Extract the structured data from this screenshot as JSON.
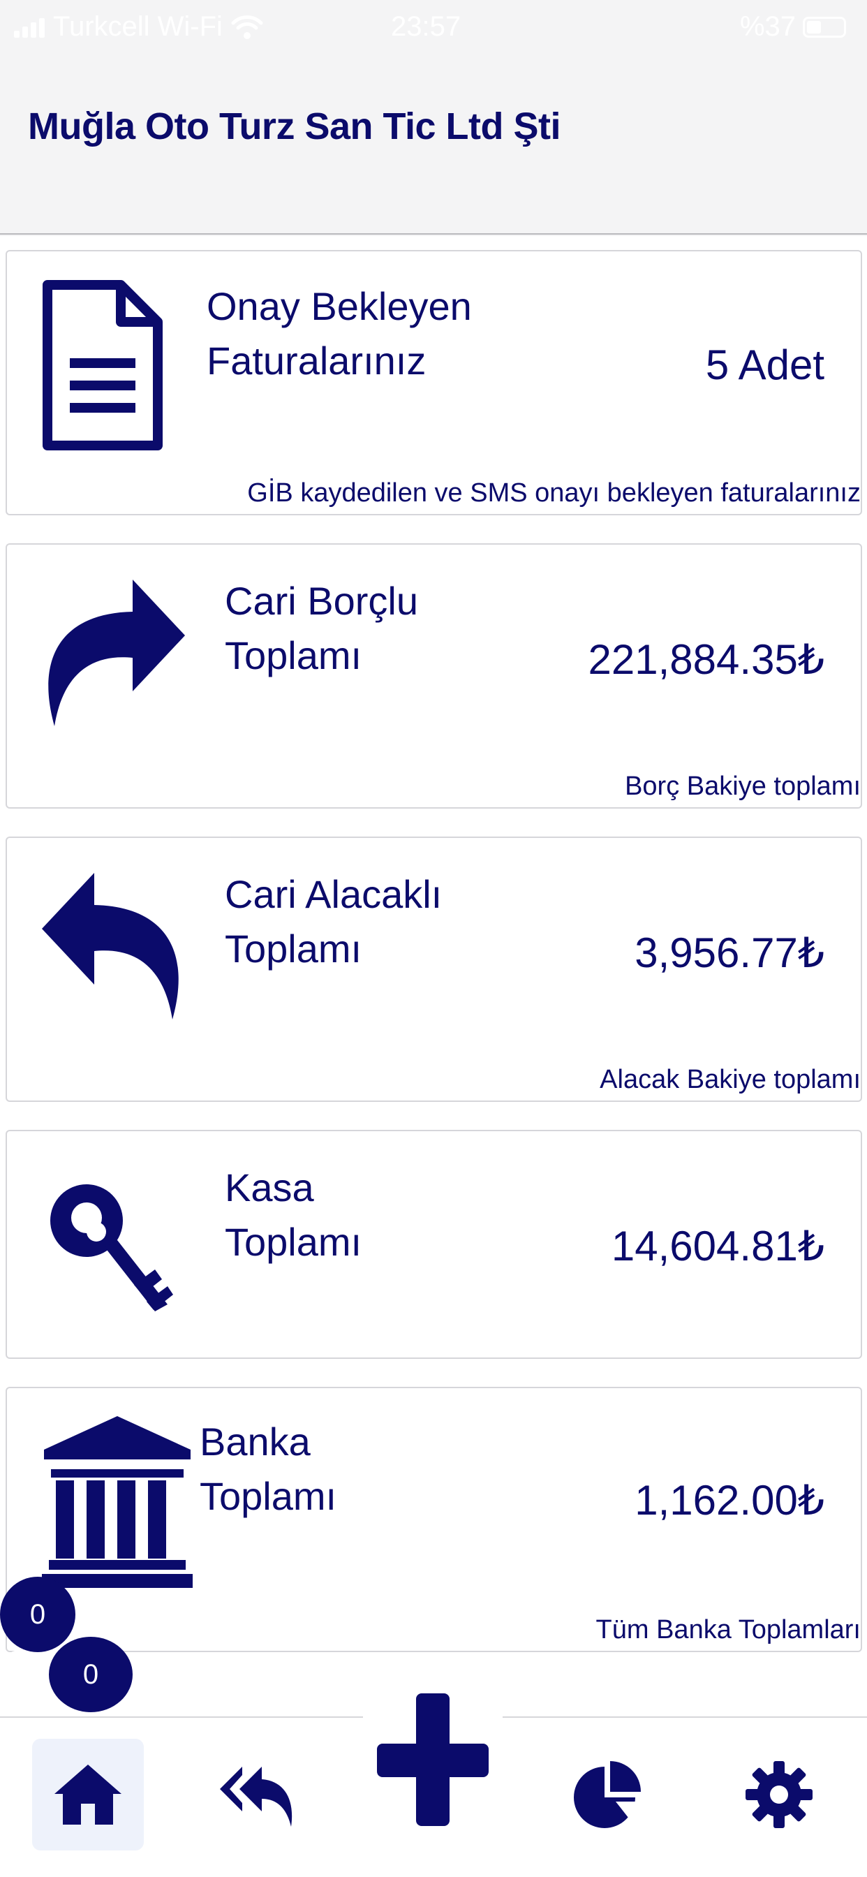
{
  "status_bar": {
    "carrier": "Turkcell Wi-Fi",
    "time": "23:57",
    "battery": "%37"
  },
  "header": {
    "title": "Muğla Oto Turz San Tic Ltd Şti"
  },
  "cards": [
    {
      "icon": "document-icon",
      "line1": "Onay Bekleyen",
      "line2": "Faturalarınız",
      "value": "5 Adet",
      "footer": "GİB kaydedilen ve SMS onayı bekleyen faturalarınız"
    },
    {
      "icon": "share-forward-icon",
      "line1": "Cari Borçlu",
      "line2": "Toplamı",
      "value": "221,884.35₺",
      "footer": "Borç Bakiye toplamı"
    },
    {
      "icon": "reply-back-icon",
      "line1": "Cari Alacaklı",
      "line2": "Toplamı",
      "value": "3,956.77₺",
      "footer": "Alacak Bakiye toplamı"
    },
    {
      "icon": "key-icon",
      "line1": "Kasa",
      "line2": "Toplamı",
      "value": "14,604.81₺",
      "footer": ""
    },
    {
      "icon": "bank-icon",
      "line1": "Banka",
      "line2": "Toplamı",
      "value": "1,162.00₺",
      "footer": "Tüm Banka Toplamları"
    }
  ],
  "chat": {
    "count_top": "0",
    "count_bottom": "0"
  },
  "tabbar": {
    "items": [
      {
        "icon": "home-icon",
        "active": true
      },
      {
        "icon": "reply-all-icon",
        "active": false
      },
      {
        "icon": "plus-icon",
        "active": false
      },
      {
        "icon": "pie-chart-icon",
        "active": false
      },
      {
        "icon": "gear-icon",
        "active": false
      }
    ]
  },
  "colors": {
    "primary": "#0b0b6b",
    "background": "#ffffff",
    "header_bg": "#f4f4f5"
  }
}
